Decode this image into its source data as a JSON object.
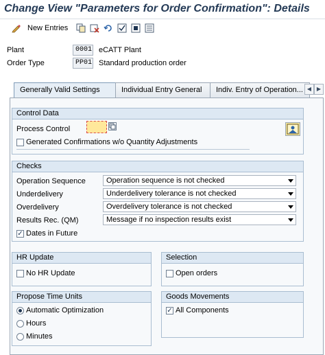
{
  "window": {
    "title": "Change View \"Parameters for Order Confirmation\": Details"
  },
  "toolbar": {
    "new_entries_label": "New Entries"
  },
  "header": {
    "plant": {
      "label": "Plant",
      "value": "0001",
      "description": "eCATT Plant"
    },
    "order_type": {
      "label": "Order Type",
      "value": "PP01",
      "description": "Standard production order"
    }
  },
  "tabs": [
    {
      "label": "Generally Valid Settings",
      "active": true
    },
    {
      "label": "Individual Entry General",
      "active": false
    },
    {
      "label": "Indiv. Entry of Operation...",
      "active": false
    }
  ],
  "control_data": {
    "title": "Control Data",
    "process_control_label": "Process Control",
    "process_control_value": "",
    "generated_confirmations_label": "Generated Confirmations w/o Quantity Adjustments",
    "generated_confirmations_checked": false
  },
  "checks": {
    "title": "Checks",
    "operation_sequence": {
      "label": "Operation Sequence",
      "value": "Operation sequence is not checked"
    },
    "underdelivery": {
      "label": "Underdelivery",
      "value": "Underdelivery tolerance is not checked"
    },
    "overdelivery": {
      "label": "Overdelivery",
      "value": "Overdelivery tolerance is not checked"
    },
    "results_rec": {
      "label": "Results Rec. (QM)",
      "value": "Message if no inspection results exist"
    },
    "dates_in_future": {
      "label": "Dates in Future",
      "checked": true
    }
  },
  "hr_update": {
    "title": "HR Update",
    "no_hr_update_label": "No HR Update",
    "no_hr_update_checked": false
  },
  "selection": {
    "title": "Selection",
    "open_orders_label": "Open orders",
    "open_orders_checked": false
  },
  "propose_time_units": {
    "title": "Propose Time Units",
    "options": [
      "Automatic Optimization",
      "Hours",
      "Minutes"
    ],
    "selected": "Automatic Optimization"
  },
  "goods_movements": {
    "title": "Goods Movements",
    "all_components_label": "All Components",
    "all_components_checked": true
  }
}
